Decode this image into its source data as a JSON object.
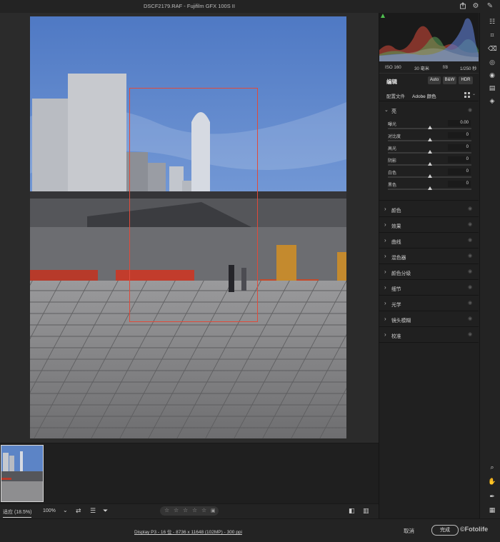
{
  "window": {
    "title": "DSCF2179.RAF  -  Fujifilm GFX 100S II"
  },
  "exif": {
    "iso": "ISO 160",
    "focal": "30 毫米",
    "aperture": "f/8",
    "shutter": "1/250 秒"
  },
  "edit": {
    "label": "编辑",
    "modes": [
      "Auto",
      "B&W",
      "HDR"
    ],
    "profile_label": "配置文件",
    "profile_value": "Adobe 颜色"
  },
  "light": {
    "label": "亮",
    "sliders": [
      {
        "label": "曝光",
        "value": "0.00",
        "position": 0.5
      },
      {
        "label": "对比度",
        "value": "0",
        "position": 0.5
      },
      {
        "label": "高光",
        "value": "0",
        "position": 0.5
      },
      {
        "label": "阴影",
        "value": "0",
        "position": 0.5
      },
      {
        "label": "白色",
        "value": "0",
        "position": 0.5
      },
      {
        "label": "黑色",
        "value": "0",
        "position": 0.5
      }
    ]
  },
  "sections": [
    "颜色",
    "效果",
    "曲线",
    "混色器",
    "颜色分级",
    "细节",
    "光学",
    "镜头模糊",
    "校准"
  ],
  "bottombar": {
    "fit_zoom": "适应 (18.5%)",
    "zoom_100": "100%",
    "zoom_caret": "⌄"
  },
  "status": {
    "file_info": "Display P3 - 16 位 - 8736 x 11648 (102MP) - 300 ppi",
    "cancel": "取消",
    "done": "完成",
    "watermark": "©Fotolife"
  },
  "colors": {
    "crop_rect": "#e04a3a",
    "panel_bg": "#202020",
    "canvas_bg": "#2b2b2b",
    "histo_red": "#d94a3a",
    "histo_green": "#5aa35a",
    "histo_blue": "#5a78c8"
  },
  "icons": {
    "titlebar": [
      "share-icon",
      "gear-icon",
      "edit-pen-icon"
    ],
    "tools": [
      "sliders-icon",
      "crop-icon",
      "eraser-icon",
      "mask-icon",
      "redeye-icon",
      "presets-icon",
      "layers-icon",
      "zoom-icon",
      "hand-icon",
      "eyedropper-icon",
      "grid-icon"
    ],
    "bottombar": [
      "compare-icon",
      "sort-icon",
      "filter-icon",
      "trash-icon",
      "before-after-icon",
      "split-view-icon"
    ]
  }
}
